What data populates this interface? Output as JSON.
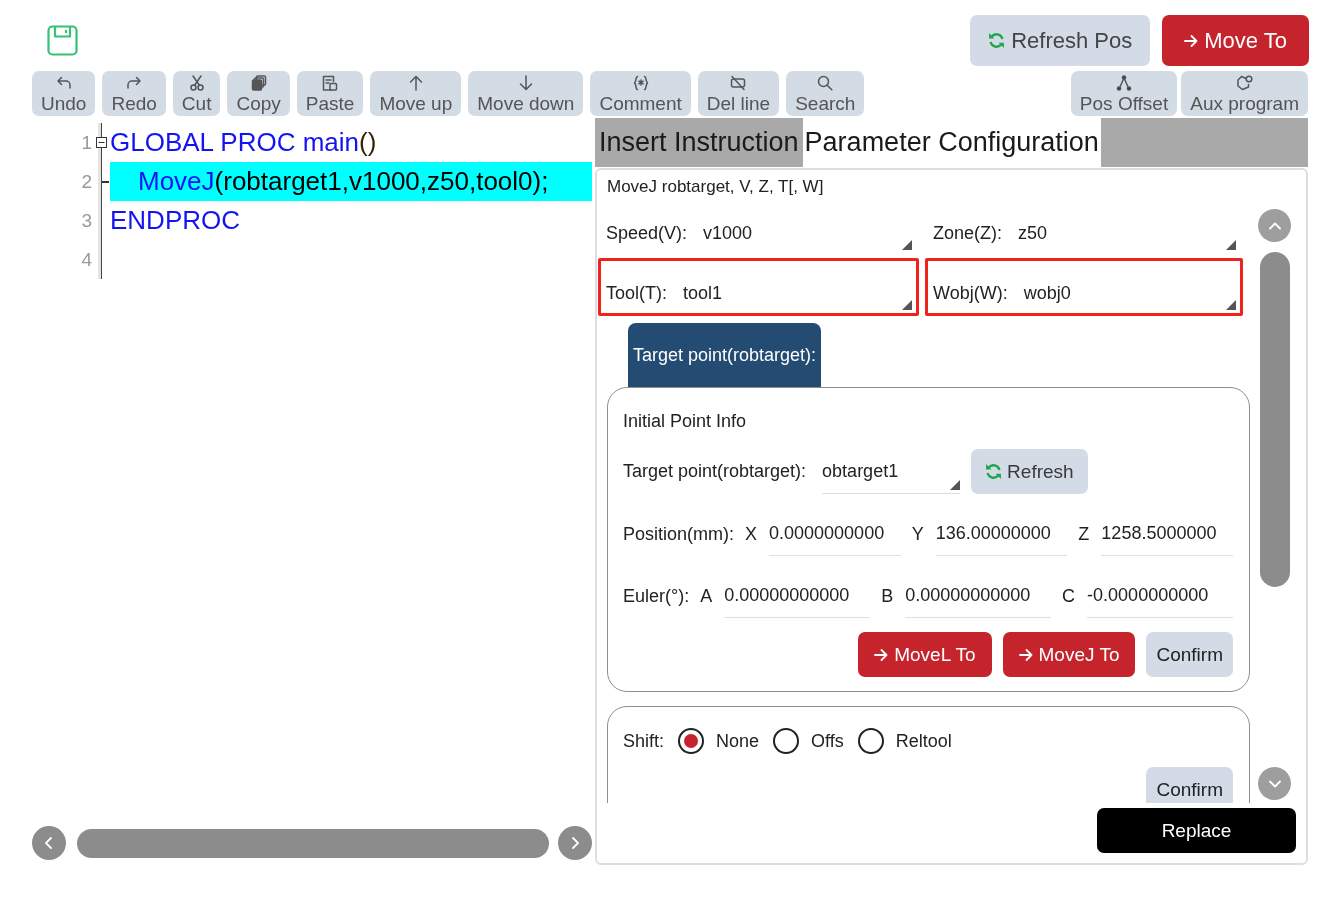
{
  "header": {
    "buttons": [
      {
        "label": "Refresh Pos",
        "kind": "refresh"
      },
      {
        "label": "Move To",
        "kind": "move"
      }
    ]
  },
  "toolbar": {
    "left": [
      "Undo",
      "Redo",
      "Cut",
      "Copy",
      "Paste",
      "Move up",
      "Move down",
      "Comment",
      "Del line",
      "Search"
    ],
    "right": [
      "Pos Offset",
      "Aux program"
    ]
  },
  "editor": {
    "lines": [
      {
        "number": "1",
        "highlighted": false,
        "expanded": true,
        "tokens": [
          {
            "text": "GLOBAL PROC main",
            "kind": "keyword"
          },
          {
            "text": "()",
            "kind": "bracket"
          }
        ],
        "children": [
          {
            "number": "2",
            "highlighted": true,
            "tokens": [
              {
                "text": "MoveJ",
                "kind": "keyword"
              },
              {
                "text": "(robtarget1,v1000,z50,tool0);",
                "kind": "plain"
              }
            ]
          }
        ]
      },
      {
        "number": "3",
        "highlighted": false,
        "tokens": [
          {
            "text": "ENDPROC",
            "kind": "keyword"
          }
        ]
      },
      {
        "number": "4",
        "highlighted": false
      }
    ]
  },
  "instruction_panel": {
    "tabs": [
      {
        "label": "Insert Instruction",
        "selected": false
      },
      {
        "label": "Parameter Configuration",
        "selected": true
      }
    ],
    "syntax": "MoveJ robtarget, V, Z, T[, W]",
    "fields": [
      {
        "label": "Speed(V):",
        "value": "v1000",
        "highlighted": false
      },
      {
        "label": "Zone(Z):",
        "value": "z50",
        "highlighted": false
      },
      {
        "label": "Tool(T):",
        "value": "tool1",
        "highlighted": true
      },
      {
        "label": "Wobj(W):",
        "value": "wobj0",
        "highlighted": true
      }
    ],
    "point_tabs": [
      {
        "label": "Target point(robtarget):",
        "selected": true
      }
    ],
    "initial_point": {
      "title": "Initial Point Info",
      "target": {
        "label": "Target point(robtarget):",
        "value": "obtarget1",
        "button": {
          "label": "Refresh",
          "kind": "refresh"
        }
      },
      "position": {
        "label": "Position(mm):",
        "coords": [
          {
            "axis": "X",
            "value": "0.0000000000"
          },
          {
            "axis": "Y",
            "value": "136.00000000"
          },
          {
            "axis": "Z",
            "value": "1258.5000000"
          }
        ]
      },
      "euler": {
        "label": "Euler(°):",
        "coords": [
          {
            "axis": "A",
            "value": "0.00000000000"
          },
          {
            "axis": "B",
            "value": "0.00000000000"
          },
          {
            "axis": "C",
            "value": "-0.0000000000"
          }
        ]
      },
      "buttons": [
        {
          "label": "MoveL To",
          "kind": "move"
        },
        {
          "label": "MoveJ To",
          "kind": "move"
        },
        {
          "label": "Confirm",
          "kind": "plain"
        }
      ]
    },
    "shift": {
      "label": "Shift:",
      "options": [
        {
          "label": "None",
          "selected": true
        },
        {
          "label": "Offs",
          "selected": false
        },
        {
          "label": "Reltool",
          "selected": false
        }
      ],
      "buttons": [
        {
          "label": "Confirm",
          "kind": "plain"
        }
      ]
    },
    "footer_buttons": [
      {
        "label": "Replace",
        "kind": "primary"
      }
    ]
  }
}
